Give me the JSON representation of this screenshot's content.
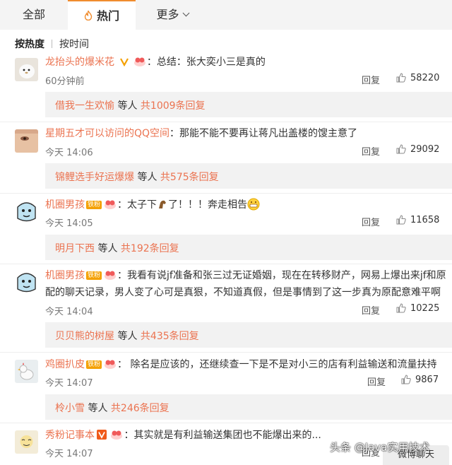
{
  "tabs": {
    "all": "全部",
    "hot": "热门",
    "more": "更多"
  },
  "sort": {
    "by_heat": "按热度",
    "by_time": "按时间"
  },
  "comments": [
    {
      "user": "龙抬头的爆米花",
      "text": "：总结：张大奕小三是真的",
      "time": "60分钟前",
      "reply_label": "回复",
      "likes": "58220",
      "replies": {
        "who": "借我一生欢愉",
        "etc": " 等人 ",
        "count": "共1009条回复"
      }
    },
    {
      "user": "星期五才可以访问的QQ空间",
      "text": "：那能不能不要再让蒋凡出盖楼的馊主意了",
      "time": "今天 14:06",
      "reply_label": "回复",
      "likes": "29092",
      "replies": {
        "who": "锦鲤选手好运爆爆",
        "etc": " 等人 ",
        "count": "共575条回复"
      }
    },
    {
      "user": "机圈男孩",
      "badge": "铁粉",
      "text": "：太子下",
      "text_tail": "了！！！奔走相告",
      "time": "今天 14:05",
      "reply_label": "回复",
      "likes": "11658",
      "replies": {
        "who": "明月下西",
        "etc": " 等人 ",
        "count": "共192条回复"
      }
    },
    {
      "user": "机圈男孩",
      "badge": "铁粉",
      "text": "：我看有说jf准备和张三过无证婚姻，现在在转移财产，网易上爆出来jf和原",
      "text2": "配的聊天记录，男人变了心可是真狠，不知道真假，但是事情到了这一步真为原配意难平啊",
      "time": "今天 14:04",
      "reply_label": "回复",
      "likes": "10225",
      "replies": {
        "who": "贝贝熊的树屋",
        "etc": " 等人 ",
        "count": "共435条回复"
      }
    },
    {
      "user": "鸡圈扒皮",
      "badge": "铁粉",
      "text": "： 除名是应该的，还继续查一下是不是对小三的店有利益输送和流量扶持",
      "time": "今天 14:07",
      "reply_label": "回复",
      "likes": "9867",
      "replies": {
        "who": "柃小雪",
        "etc": " 等人 ",
        "count": "共246条回复"
      }
    },
    {
      "user": "秀粉记事本",
      "text": "：其实就是有利益输送集团也不能爆出来的...",
      "time": "今天 14:07",
      "reply_label": "回复"
    }
  ],
  "watermark": "头条 @Java实用技术",
  "float_chat": "微博聊天",
  "colors": {
    "username": "#eb7350",
    "tab_accent": "#f08c2e",
    "badge": "#f4a000"
  }
}
